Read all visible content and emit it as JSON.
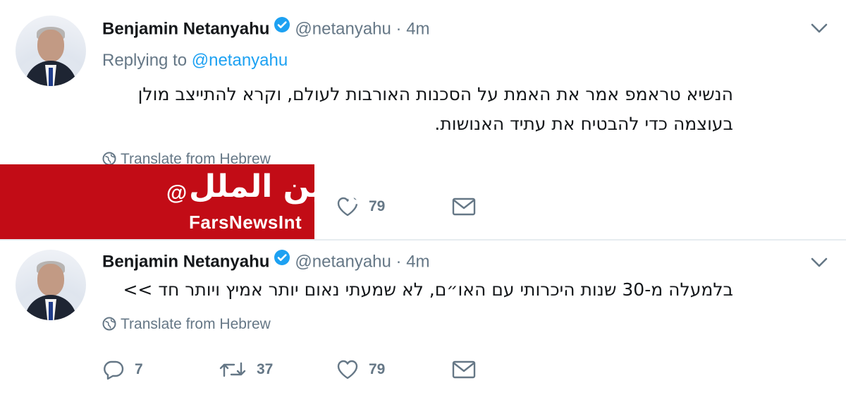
{
  "tweets": [
    {
      "name": "Benjamin Netanyahu",
      "handle": "@netanyahu",
      "separator": "·",
      "time": "4m",
      "reply_prefix": "Replying to ",
      "reply_handle": "@netanyahu",
      "text": "הנשיא טראמפ אמר את האמת על הסכנות האורבות לעולם, וקרא להתייצב מולן בעוצמה כדי להבטיח את עתיד האנושות.",
      "translate": "Translate from Hebrew",
      "likes": "79",
      "icons": [
        "verified-icon",
        "chevron-down-icon",
        "globe-icon",
        "heart-icon",
        "mail-icon"
      ]
    },
    {
      "name": "Benjamin Netanyahu",
      "handle": "@netanyahu",
      "separator": "·",
      "time": "4m",
      "text": "בלמעלה מ-30 שנות היכרותי עם האו״ם, לא שמעתי נאום יותר אמיץ ויותר חד >>",
      "translate": "Translate from Hebrew",
      "replies": "7",
      "retweets": "37",
      "likes": "79",
      "icons": [
        "verified-icon",
        "chevron-down-icon",
        "globe-icon",
        "reply-icon",
        "retweet-icon",
        "heart-icon",
        "mail-icon"
      ]
    }
  ],
  "overlay": {
    "arabic_logo": "فارس بين الملل",
    "at_symbol": "@",
    "brand": "FarsNewsInt"
  },
  "colors": {
    "link": "#1da1f2",
    "muted": "#657786",
    "text": "#14171a",
    "verified": "#1da1f2",
    "overlay_red": "#c20c16"
  }
}
